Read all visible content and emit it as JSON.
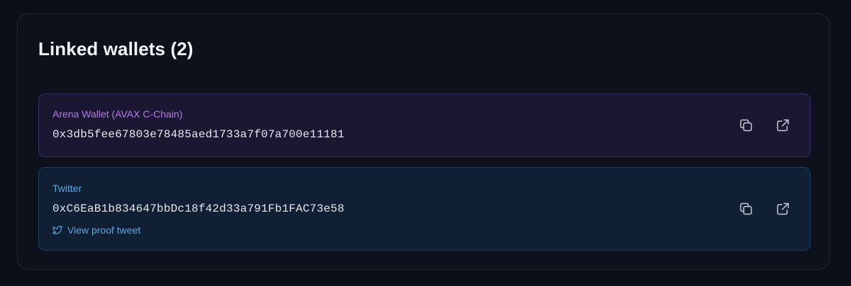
{
  "section": {
    "title": "Linked wallets (2)"
  },
  "wallets": [
    {
      "label": "Arena Wallet (AVAX C-Chain)",
      "address": "0x3db5fee67803e78485aed1733a7f07a700e11181",
      "label_color": "#b57ae8",
      "icons": [
        "copy-icon",
        "external-link-icon"
      ]
    },
    {
      "label": "Twitter",
      "address": "0xC6EaB1b834647bbDc18f42d33a791Fb1FAC73e58",
      "label_color": "#5aa9e0",
      "proof_link": "View proof tweet",
      "icons": [
        "twitter-bird-icon",
        "copy-icon",
        "external-link-icon"
      ]
    }
  ]
}
